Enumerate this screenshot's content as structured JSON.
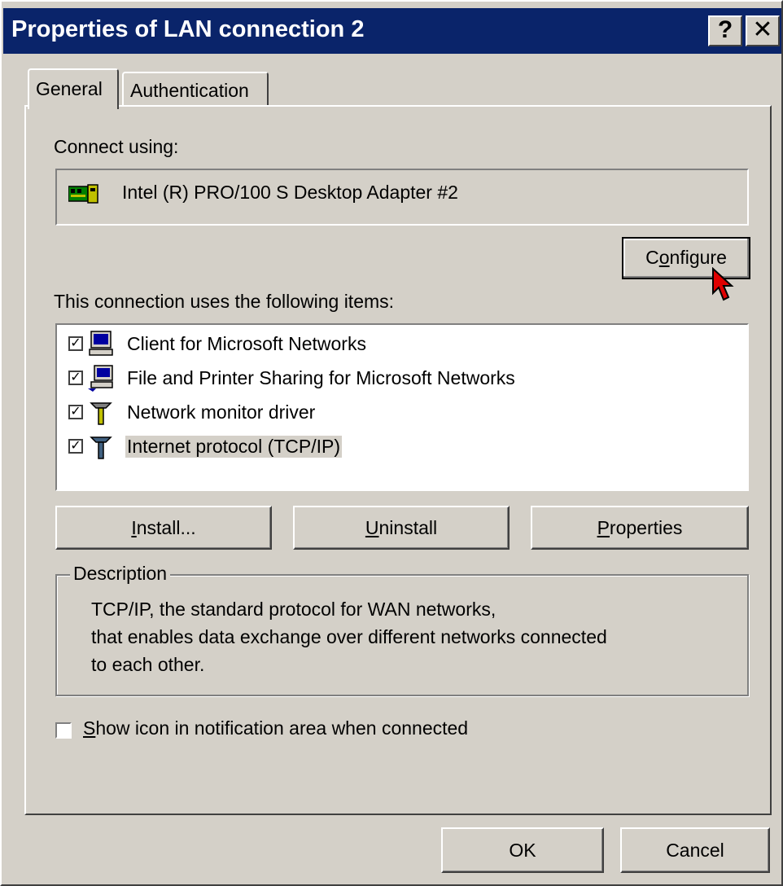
{
  "window": {
    "title": "Properties of LAN connection 2",
    "help_label": "?",
    "close_label": "✕"
  },
  "tabs": [
    {
      "label": "General",
      "active": true
    },
    {
      "label": "Authentication",
      "active": false
    }
  ],
  "general": {
    "connect_using_label": "Connect using:",
    "adapter": {
      "name": "Intel (R) PRO/100 S Desktop Adapter #2",
      "icon": "network-adapter-icon"
    },
    "configure": {
      "pre": "C",
      "accel": "o",
      "post": "nfigure"
    },
    "items_label": "This connection uses the following items:",
    "items": [
      {
        "label": "Client for Microsoft Networks",
        "checked": true,
        "icon": "computer-icon",
        "selected": false
      },
      {
        "label": "File and Printer Sharing for Microsoft Networks",
        "checked": true,
        "icon": "computer-share-icon",
        "selected": false
      },
      {
        "label": "Network monitor driver",
        "checked": true,
        "icon": "network-protocol-icon",
        "selected": false
      },
      {
        "label": "Internet protocol (TCP/IP)",
        "checked": true,
        "icon": "network-protocol-icon",
        "selected": true
      }
    ],
    "install": {
      "pre": "",
      "accel": "I",
      "post": "nstall..."
    },
    "uninstall": {
      "pre": "",
      "accel": "U",
      "post": "ninstall"
    },
    "properties": {
      "pre": "",
      "accel": "P",
      "post": "roperties"
    },
    "description": {
      "legend": "Description",
      "lines": [
        "TCP/IP, the standard protocol for WAN networks,",
        "that enables data exchange over different networks connected",
        "to each other."
      ]
    },
    "notify": {
      "pre": "",
      "accel": "S",
      "post": "how icon in notification area when connected",
      "checked": false
    }
  },
  "footer": {
    "ok_label": "OK",
    "cancel_label": "Cancel"
  },
  "colors": {
    "titlebar": "#0a246a",
    "face": "#d4d0c8",
    "cursor": "#e00000"
  }
}
